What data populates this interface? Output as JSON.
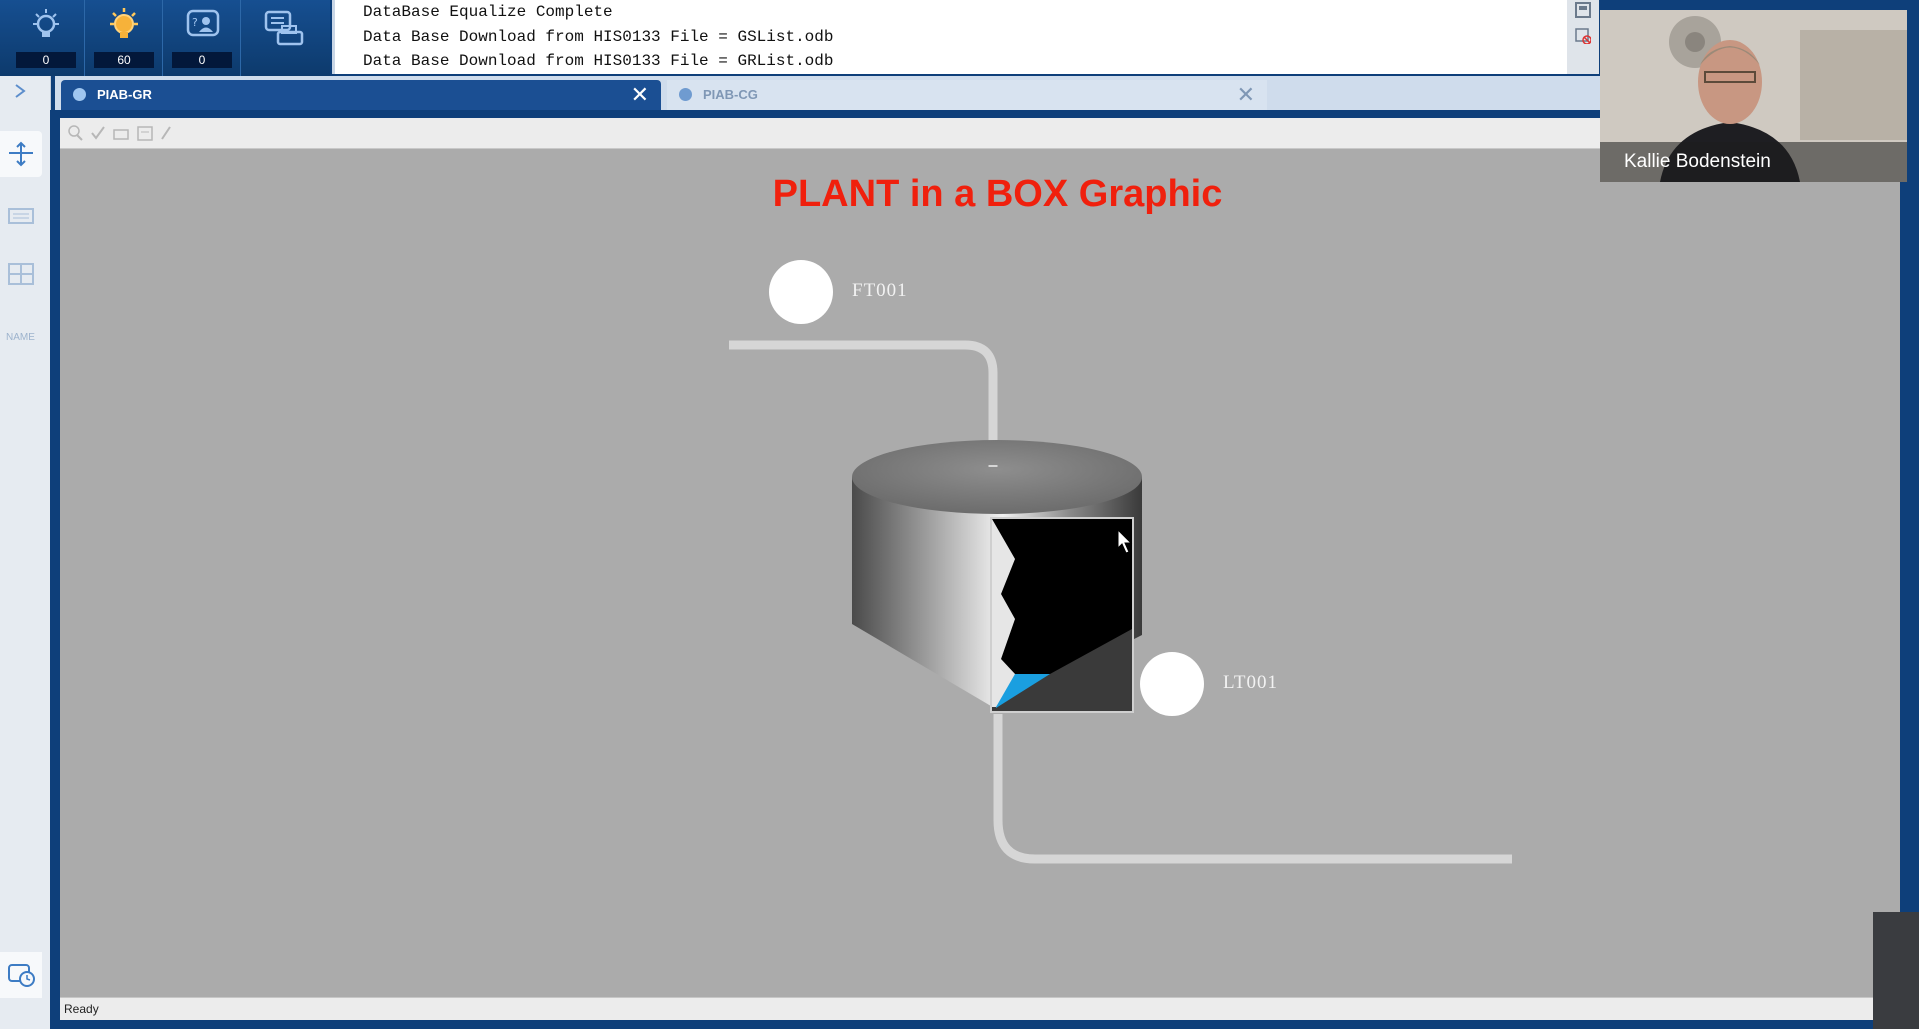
{
  "toolbar": {
    "alarm_count": "0",
    "active_alarm_count": "60",
    "operator_msg_count": "0"
  },
  "messages": [
    "DataBase Equalize Complete",
    "Data Base Download from HIS0133 File = GSList.odb",
    "Data Base Download from HIS0133 File = GRList.odb"
  ],
  "tabs": [
    {
      "label": "PIAB-GR",
      "active": true
    },
    {
      "label": "PIAB-CG",
      "active": false
    }
  ],
  "sidebar": {
    "name_label": "NAME"
  },
  "graphic": {
    "title": "PLANT in a BOX Graphic",
    "flow_tag": "FT001",
    "level_tag": "LT001"
  },
  "status": "Ready",
  "video": {
    "participant": "Kallie Bodenstein"
  },
  "colors": {
    "title_red": "#f0200d",
    "level_blue": "#1a9fe0",
    "canvas_gray": "#ababab",
    "toolbar_blue": "#164f91"
  }
}
